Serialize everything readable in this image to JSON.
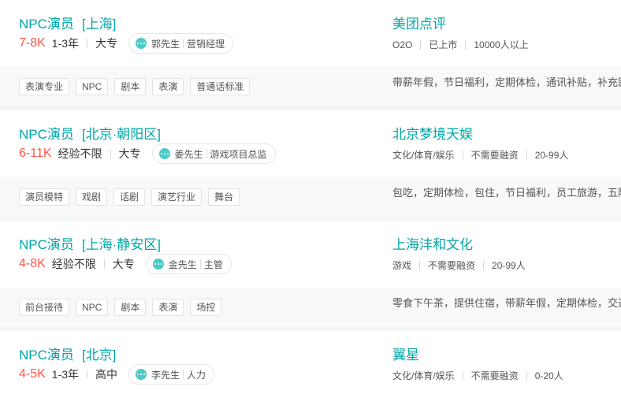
{
  "jobs": [
    {
      "title": "NPC演员",
      "location": "[上海]",
      "salary": "7-8K",
      "experience": "1-3年",
      "education": "大专",
      "recruiter_name": "郭先生",
      "recruiter_title": "营销经理",
      "company": "美团点评",
      "company_info": [
        "O2O",
        "已上市",
        "10000人以上"
      ],
      "tags": [
        "表演专业",
        "NPC",
        "剧本",
        "表演",
        "普通话标准"
      ],
      "benefits": "带薪年假，节日福利，定期体检，通讯补贴，补充医"
    },
    {
      "title": "NPC演员",
      "location": "[北京·朝阳区]",
      "salary": "6-11K",
      "experience": "经验不限",
      "education": "大专",
      "recruiter_name": "姜先生",
      "recruiter_title": "游戏项目总监",
      "company": "北京梦境天娱",
      "company_info": [
        "文化/体育/娱乐",
        "不需要融资",
        "20-99人"
      ],
      "tags": [
        "演员模特",
        "戏剧",
        "话剧",
        "演艺行业",
        "舞台"
      ],
      "benefits": "包吃，定期体检，包住，节日福利，员工旅游，五险"
    },
    {
      "title": "NPC演员",
      "location": "[上海·静安区]",
      "salary": "4-8K",
      "experience": "经验不限",
      "education": "大专",
      "recruiter_name": "金先生",
      "recruiter_title": "主管",
      "company": "上海沣和文化",
      "company_info": [
        "游戏",
        "不需要融资",
        "20-99人"
      ],
      "tags": [
        "前台接待",
        "NPC",
        "剧本",
        "表演",
        "场控"
      ],
      "benefits": "零食下午茶，提供住宿，带薪年假，定期体检，交通"
    },
    {
      "title": "NPC演员",
      "location": "[北京]",
      "salary": "4-5K",
      "experience": "1-3年",
      "education": "高中",
      "recruiter_name": "李先生",
      "recruiter_title": "人力",
      "company": "翼星",
      "company_info": [
        "文化/体育/娱乐",
        "不需要融资",
        "0-20人"
      ],
      "tags": [],
      "benefits": ""
    }
  ]
}
